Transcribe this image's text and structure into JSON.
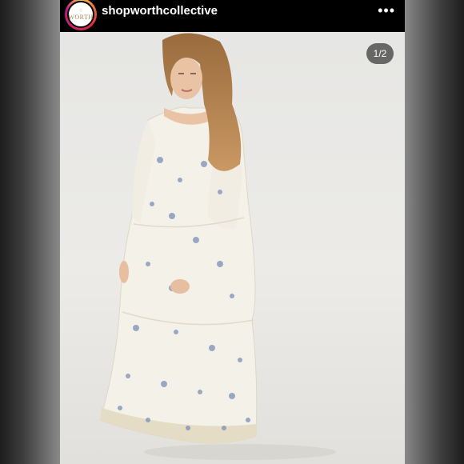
{
  "post": {
    "username": "shopworthcollective",
    "avatar_text": "WORTH",
    "more_glyph": "•••",
    "image_counter": "1/2",
    "image_index": 1,
    "image_total": 2
  },
  "colors": {
    "ring_start": "#f7c04a",
    "ring_end": "#bc1888",
    "dress": "#f4f1e8",
    "floral": "#7d8fb8"
  },
  "icons": {
    "more": "more-horizontal-icon"
  }
}
